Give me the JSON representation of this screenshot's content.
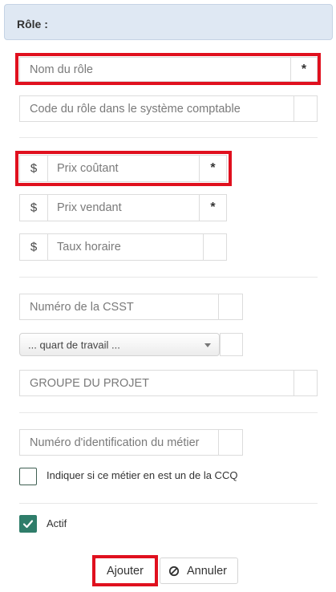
{
  "header": {
    "title": "Rôle :"
  },
  "role_name": {
    "placeholder": "Nom du rôle",
    "required_mark": "*"
  },
  "accounting_code": {
    "placeholder": "Code du rôle dans le système comptable"
  },
  "cost_price": {
    "prefix": "$",
    "placeholder": "Prix coûtant",
    "required_mark": "*"
  },
  "sale_price": {
    "prefix": "$",
    "placeholder": "Prix vendant",
    "required_mark": "*"
  },
  "hourly_rate": {
    "prefix": "$",
    "placeholder": "Taux horaire"
  },
  "csst_number": {
    "placeholder": "Numéro de la CSST"
  },
  "shift_select": {
    "value": "... quart de travail ..."
  },
  "project_group": {
    "placeholder": "GROUPE DU PROJET"
  },
  "trade_id": {
    "placeholder": "Numéro d'identification du métier"
  },
  "ccq_checkbox": {
    "label": "Indiquer si ce métier en est un de la CCQ",
    "checked": false
  },
  "active_checkbox": {
    "label": "Actif",
    "checked": true
  },
  "actions": {
    "add_label": "Ajouter",
    "cancel_label": "Annuler"
  },
  "colors": {
    "highlight": "#e0101e",
    "header_bg": "#dfe8f3",
    "check": "#2f7d6a"
  },
  "icons": {
    "cancel": "ban-icon",
    "checkmark": "checkmark-icon"
  }
}
